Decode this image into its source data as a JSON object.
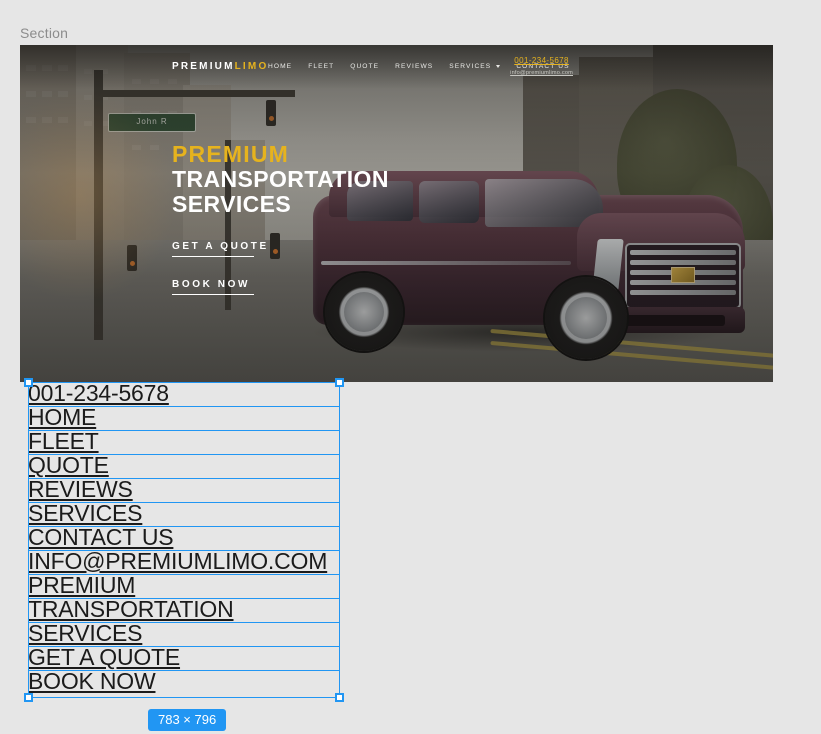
{
  "panel": {
    "section_label": "Section"
  },
  "hero": {
    "logo": {
      "primary": "PREMIUM",
      "accent": "LIMO"
    },
    "nav_items": [
      {
        "label": "HOME",
        "has_caret": false
      },
      {
        "label": "FLEET",
        "has_caret": false
      },
      {
        "label": "QUOTE",
        "has_caret": false
      },
      {
        "label": "REVIEWS",
        "has_caret": false
      },
      {
        "label": "SERVICES",
        "has_caret": true
      },
      {
        "label": "CONTACT US",
        "has_caret": false
      }
    ],
    "phone": "001-234-5678",
    "email": "info@premiumlimo.com",
    "headline_line1": "PREMIUM",
    "headline_line2": "TRANSPORTATION",
    "headline_line3": "SERVICES",
    "cta_primary": "GET A QUOTE",
    "cta_secondary": "BOOK NOW",
    "street_sign": "John R"
  },
  "overlay": {
    "lines": [
      "001-234-5678",
      "HOME",
      "FLEET",
      "QUOTE",
      "REVIEWS",
      "SERVICES",
      "CONTACT US",
      "INFO@PREMIUMLIMO.COM",
      "PREMIUM",
      "TRANSPORTATION",
      "SERVICES",
      "GET A QUOTE",
      "BOOK NOW"
    ]
  },
  "selection": {
    "size_badge": "783 × 796"
  },
  "colors": {
    "accent_gold": "#e6b31e",
    "selection_blue": "#2196f3",
    "panel_bg": "#e6e6e6",
    "text_dark": "#1b1b1b"
  }
}
